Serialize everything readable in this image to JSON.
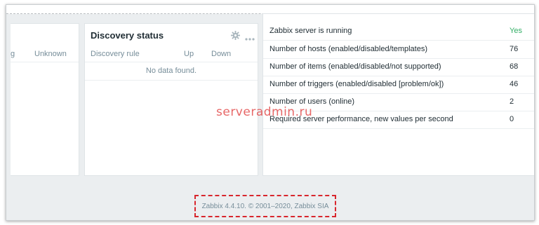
{
  "left_widget": {
    "left_col_fragment": "g",
    "unknown_header": "Unknown"
  },
  "discovery": {
    "title": "Discovery status",
    "columns": [
      "Discovery rule",
      "Up",
      "Down"
    ],
    "empty_text": "No data found.",
    "icons": [
      "gear-icon",
      "more-icon"
    ]
  },
  "system_info": {
    "rows": [
      {
        "param": "Zabbix server is running",
        "value": "Yes",
        "value_color": "#34af67"
      },
      {
        "param": "Number of hosts (enabled/disabled/templates)",
        "value": "76"
      },
      {
        "param": "Number of items (enabled/disabled/not supported)",
        "value": "68"
      },
      {
        "param": "Number of triggers (enabled/disabled [problem/ok])",
        "value": "46"
      },
      {
        "param": "Number of users (online)",
        "value": "2"
      },
      {
        "param": "Required server performance, new values per second",
        "value": "0"
      }
    ]
  },
  "watermark": "serveradmin.ru",
  "footer": {
    "text": "Zabbix 4.4.10. © 2001–2020, Zabbix SIA",
    "highlight_color": "#d8262d"
  }
}
